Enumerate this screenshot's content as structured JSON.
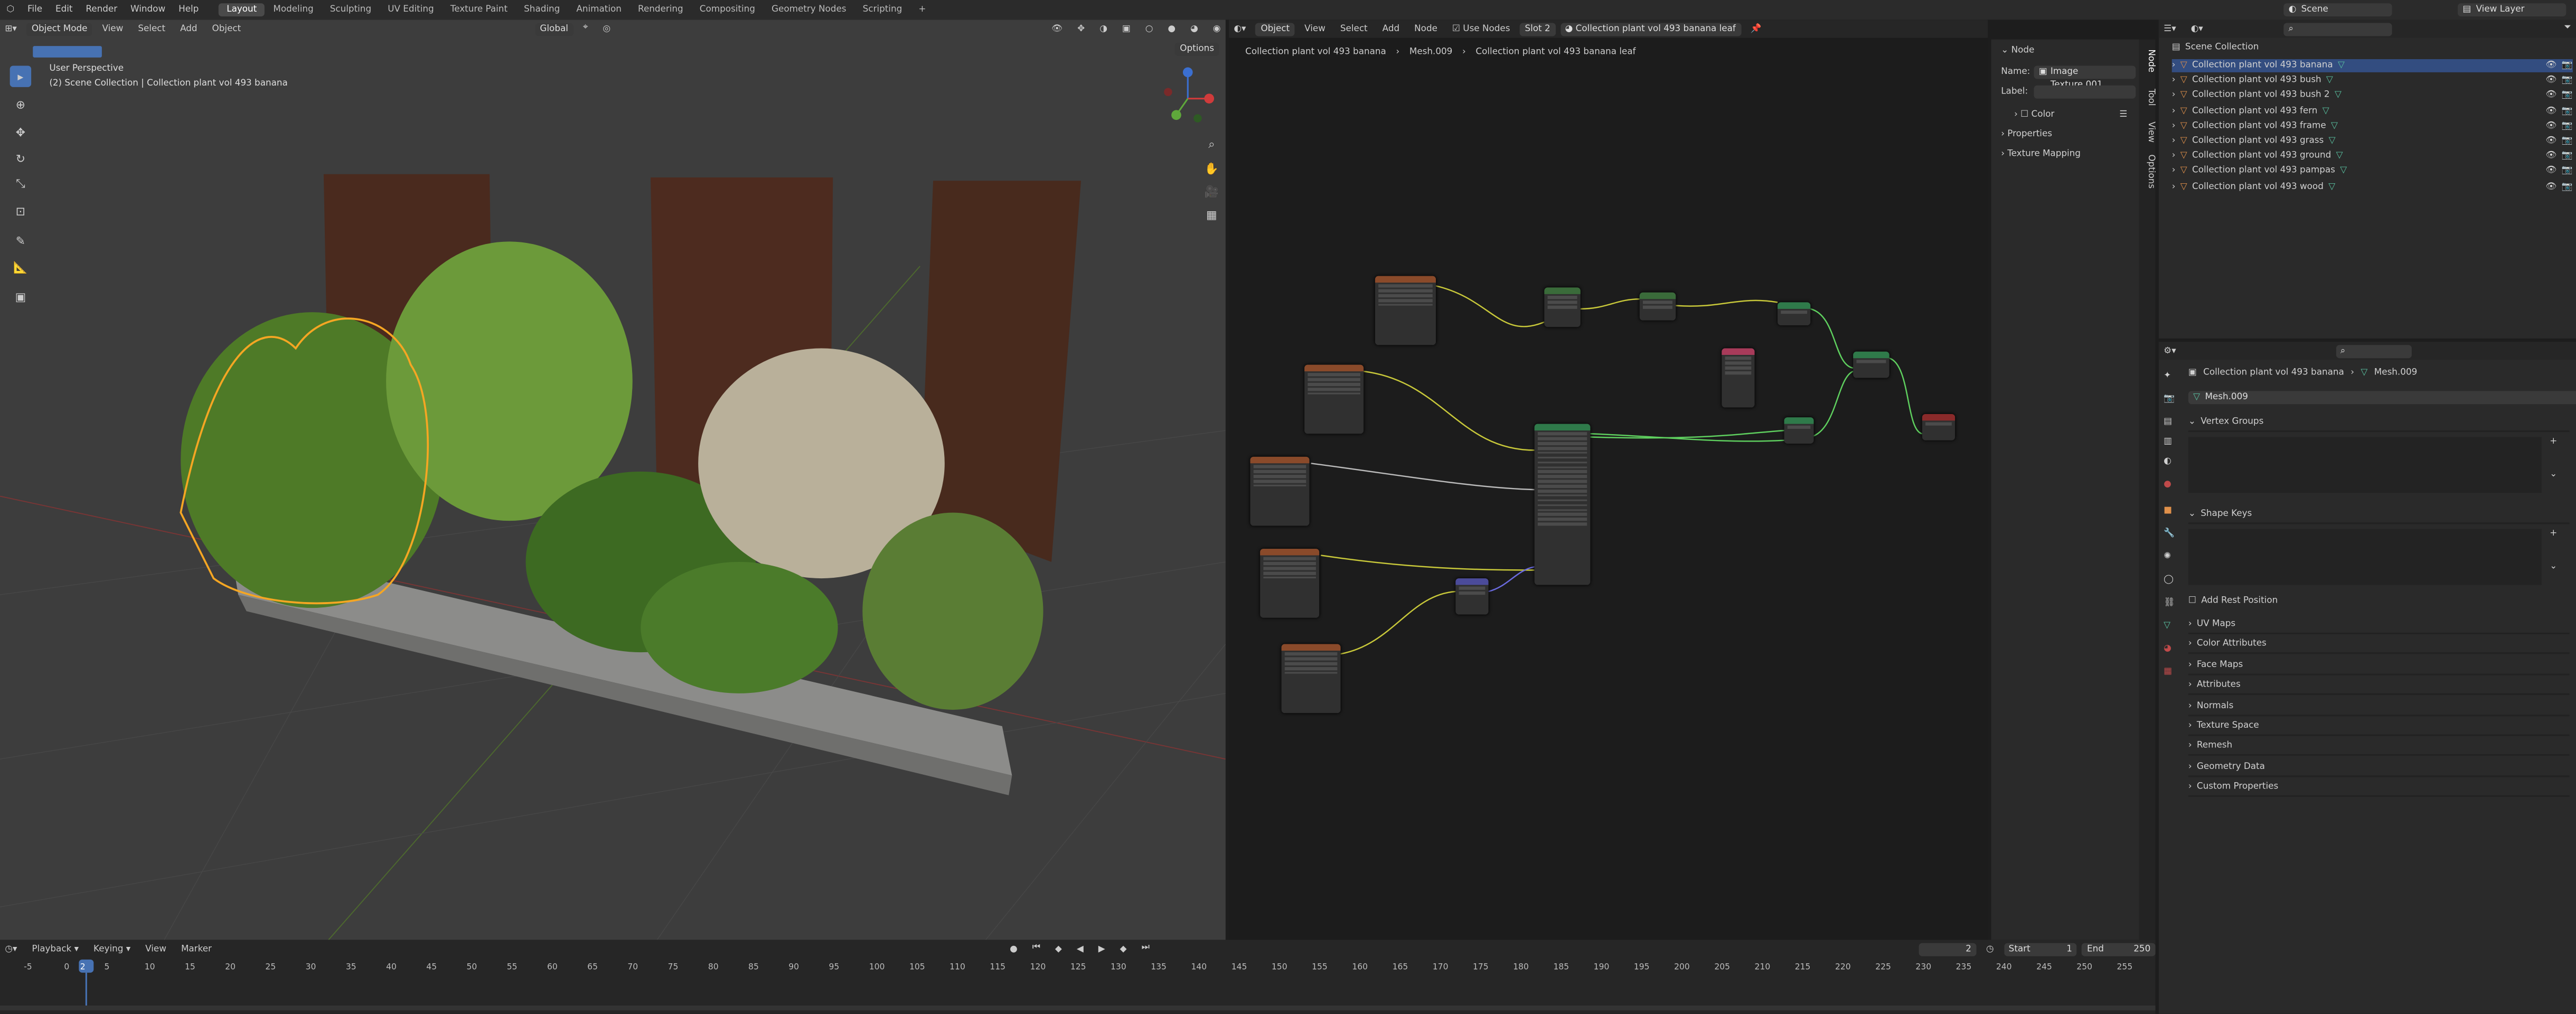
{
  "topbar": {
    "menus": [
      "File",
      "Edit",
      "Render",
      "Window",
      "Help"
    ],
    "workspaces": [
      {
        "label": "Layout",
        "active": true
      },
      {
        "label": "Modeling",
        "active": false
      },
      {
        "label": "Sculpting",
        "active": false
      },
      {
        "label": "UV Editing",
        "active": false
      },
      {
        "label": "Texture Paint",
        "active": false
      },
      {
        "label": "Shading",
        "active": false
      },
      {
        "label": "Animation",
        "active": false
      },
      {
        "label": "Rendering",
        "active": false
      },
      {
        "label": "Compositing",
        "active": false
      },
      {
        "label": "Geometry Nodes",
        "active": false
      },
      {
        "label": "Scripting",
        "active": false
      }
    ],
    "add_tab": "+",
    "scene": "Scene",
    "view_layer": "View Layer"
  },
  "viewport": {
    "mode": "Object Mode",
    "menus": [
      "View",
      "Select",
      "Add",
      "Object"
    ],
    "transform": "Global",
    "options": "Options",
    "perspective": "User Perspective",
    "collection_info": "(2) Scene Collection | Collection plant vol 493 banana"
  },
  "node_editor": {
    "object_type": "Object",
    "menus": [
      "View",
      "Select",
      "Add",
      "Node"
    ],
    "use_nodes": "Use Nodes",
    "slot": "Slot 2",
    "material": "Collection plant vol 493 banana leaf",
    "breadcrumb": [
      "Collection plant vol 493 banana",
      "Mesh.009",
      "Collection plant vol 493 banana leaf"
    ]
  },
  "node_panel": {
    "title": "Node",
    "name_label": "Name:",
    "name_value": "Image Texture.001",
    "label_label": "Label:",
    "color": "Color",
    "properties": "Properties",
    "texture_mapping": "Texture Mapping",
    "tabs": [
      "Node",
      "Tool",
      "View",
      "Options"
    ]
  },
  "outliner": {
    "root": "Scene Collection",
    "items": [
      {
        "label": "Collection plant vol 493 banana",
        "selected": true
      },
      {
        "label": "Collection plant vol 493 bush",
        "selected": false
      },
      {
        "label": "Collection plant vol 493 bush 2",
        "selected": false
      },
      {
        "label": "Collection plant vol 493 fern",
        "selected": false
      },
      {
        "label": "Collection plant vol 493 frame",
        "selected": false
      },
      {
        "label": "Collection plant vol 493 grass",
        "selected": false
      },
      {
        "label": "Collection plant vol 493 ground",
        "selected": false
      },
      {
        "label": "Collection plant vol 493 pampas",
        "selected": false
      },
      {
        "label": "Collection plant vol 493 wood",
        "selected": false
      }
    ]
  },
  "properties": {
    "breadcrumb": [
      "Collection plant vol 493 banana",
      "Mesh.009"
    ],
    "mesh_name": "Mesh.009",
    "vertex_groups": "Vertex Groups",
    "shape_keys": "Shape Keys",
    "add_rest_position": "Add Rest Position",
    "sections": [
      "UV Maps",
      "Color Attributes",
      "Face Maps",
      "Attributes",
      "Normals",
      "Texture Space",
      "Remesh",
      "Geometry Data",
      "Custom Properties"
    ]
  },
  "timeline": {
    "menus": [
      "Playback",
      "Keying",
      "View",
      "Marker"
    ],
    "current_frame": "2",
    "start_label": "Start",
    "start": "1",
    "end_label": "End",
    "end": "250",
    "ticks": [
      "-5",
      "0",
      "2",
      "5",
      "10",
      "15",
      "20",
      "25",
      "30",
      "35",
      "40",
      "45",
      "50",
      "55",
      "60",
      "65",
      "70",
      "75",
      "80",
      "85",
      "90",
      "95",
      "100",
      "105",
      "110",
      "115",
      "120",
      "125",
      "130",
      "135",
      "140",
      "145",
      "150",
      "155",
      "160",
      "165",
      "170",
      "175",
      "180",
      "185",
      "190",
      "195",
      "200",
      "205",
      "210",
      "215",
      "220",
      "225",
      "230",
      "235",
      "240",
      "245",
      "250",
      "255"
    ]
  },
  "colors": {
    "accent": "#4772b3",
    "selection_outline": "#f5a623",
    "mesh_icon": "#59c2a1",
    "collection_icon": "#e0904a"
  }
}
